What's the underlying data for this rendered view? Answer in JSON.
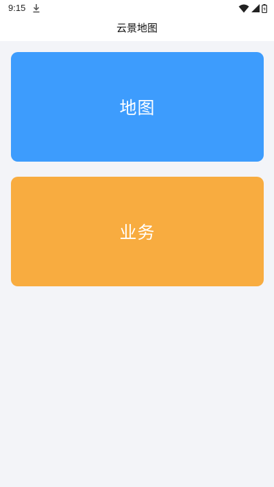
{
  "status_bar": {
    "time": "9:15",
    "icons": [
      "download-icon",
      "wifi-icon",
      "signal-icon",
      "battery-icon"
    ]
  },
  "header": {
    "title": "云景地图"
  },
  "cards": [
    {
      "label": "地图",
      "color": "#3d9cfd"
    },
    {
      "label": "业务",
      "color": "#f8ac40"
    }
  ],
  "colors": {
    "background": "#f3f4f8",
    "header_bg": "#ffffff"
  }
}
